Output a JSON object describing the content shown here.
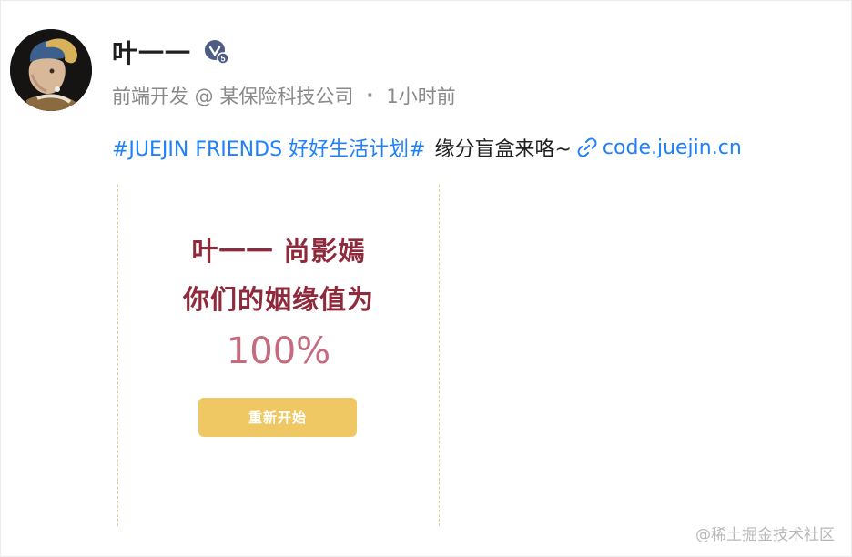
{
  "post": {
    "author": {
      "name": "叶一一",
      "level_badge": "5",
      "level_badge_icon": "verified-level-icon"
    },
    "meta": {
      "job_title": "前端开发 @ 某保险科技公司",
      "separator": "·",
      "time_ago": "1小时前"
    },
    "content": {
      "topic": "#JUEJIN FRIENDS 好好生活计划#",
      "text": "缘分盲盒来咯~",
      "link_icon": "link-icon",
      "link_text": "code.juejin.cn"
    },
    "card": {
      "line1": "叶一一 尚影嫣",
      "line2": "你们的姻缘值为",
      "percent": "100%",
      "restart_label": "重新开始"
    }
  },
  "watermark": "@稀土掘金技术社区",
  "colors": {
    "link_blue": "#1e80ff",
    "card_title": "#8e2a3c",
    "card_percent": "#c66a7f",
    "button_gold": "#f0c863",
    "border_dash": "#e6cf86"
  }
}
